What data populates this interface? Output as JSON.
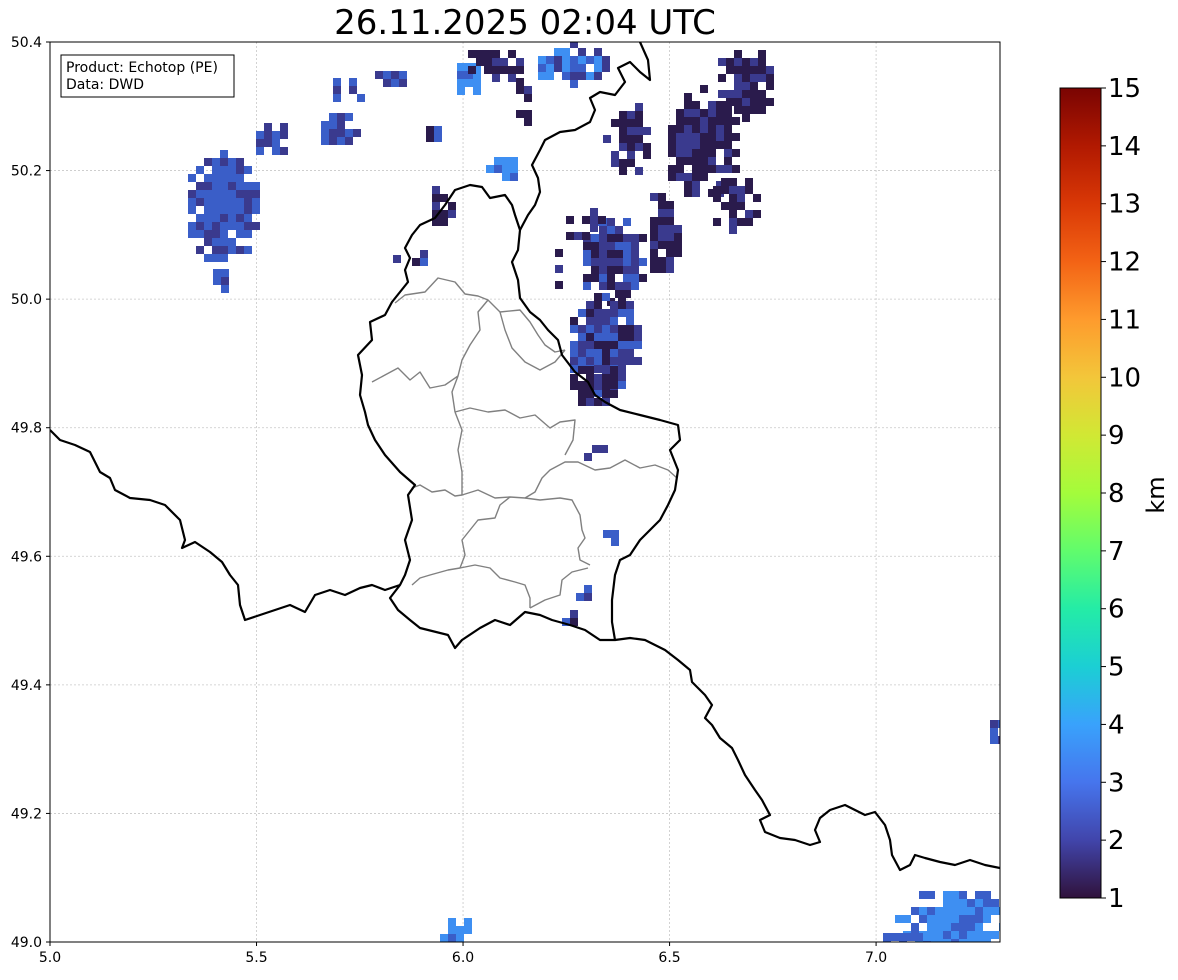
{
  "title": "26.11.2025 02:04 UTC",
  "info_box": {
    "product_line": "Product: Echotop (PE)",
    "data_line": "Data: DWD"
  },
  "map": {
    "lon_range": [
      5.0,
      7.3
    ],
    "lat_range": [
      49.0,
      50.4
    ],
    "lon_ticks": [
      "5.0",
      "5.5",
      "6.0",
      "6.5",
      "7.0"
    ],
    "lat_ticks": [
      "49.0",
      "49.2",
      "49.4",
      "49.6",
      "49.8",
      "50.0",
      "50.2",
      "50.4"
    ],
    "grid": true,
    "grid_style": "dotted",
    "country_border_color": "#000000",
    "district_border_color": "#808080",
    "echo_colors": {
      "deep_purple": "#2a1b4c",
      "indigo": "#3a3a8e",
      "blue": "#3a5ec8",
      "light_blue": "#3e8ff2"
    }
  },
  "colorbar": {
    "label": "km",
    "ticks": [
      "1",
      "2",
      "3",
      "4",
      "5",
      "6",
      "7",
      "8",
      "9",
      "10",
      "11",
      "12",
      "13",
      "14",
      "15"
    ],
    "range": [
      1,
      15
    ],
    "colormap": "turbo",
    "stops": [
      "#30123b",
      "#4145ab",
      "#4675ed",
      "#39a2fc",
      "#1bcfd4",
      "#24eca6",
      "#61fc6c",
      "#a4fc3b",
      "#d1e834",
      "#f3c63a",
      "#fe9b2d",
      "#f36315",
      "#d93806",
      "#b11901",
      "#7a0402"
    ]
  }
}
